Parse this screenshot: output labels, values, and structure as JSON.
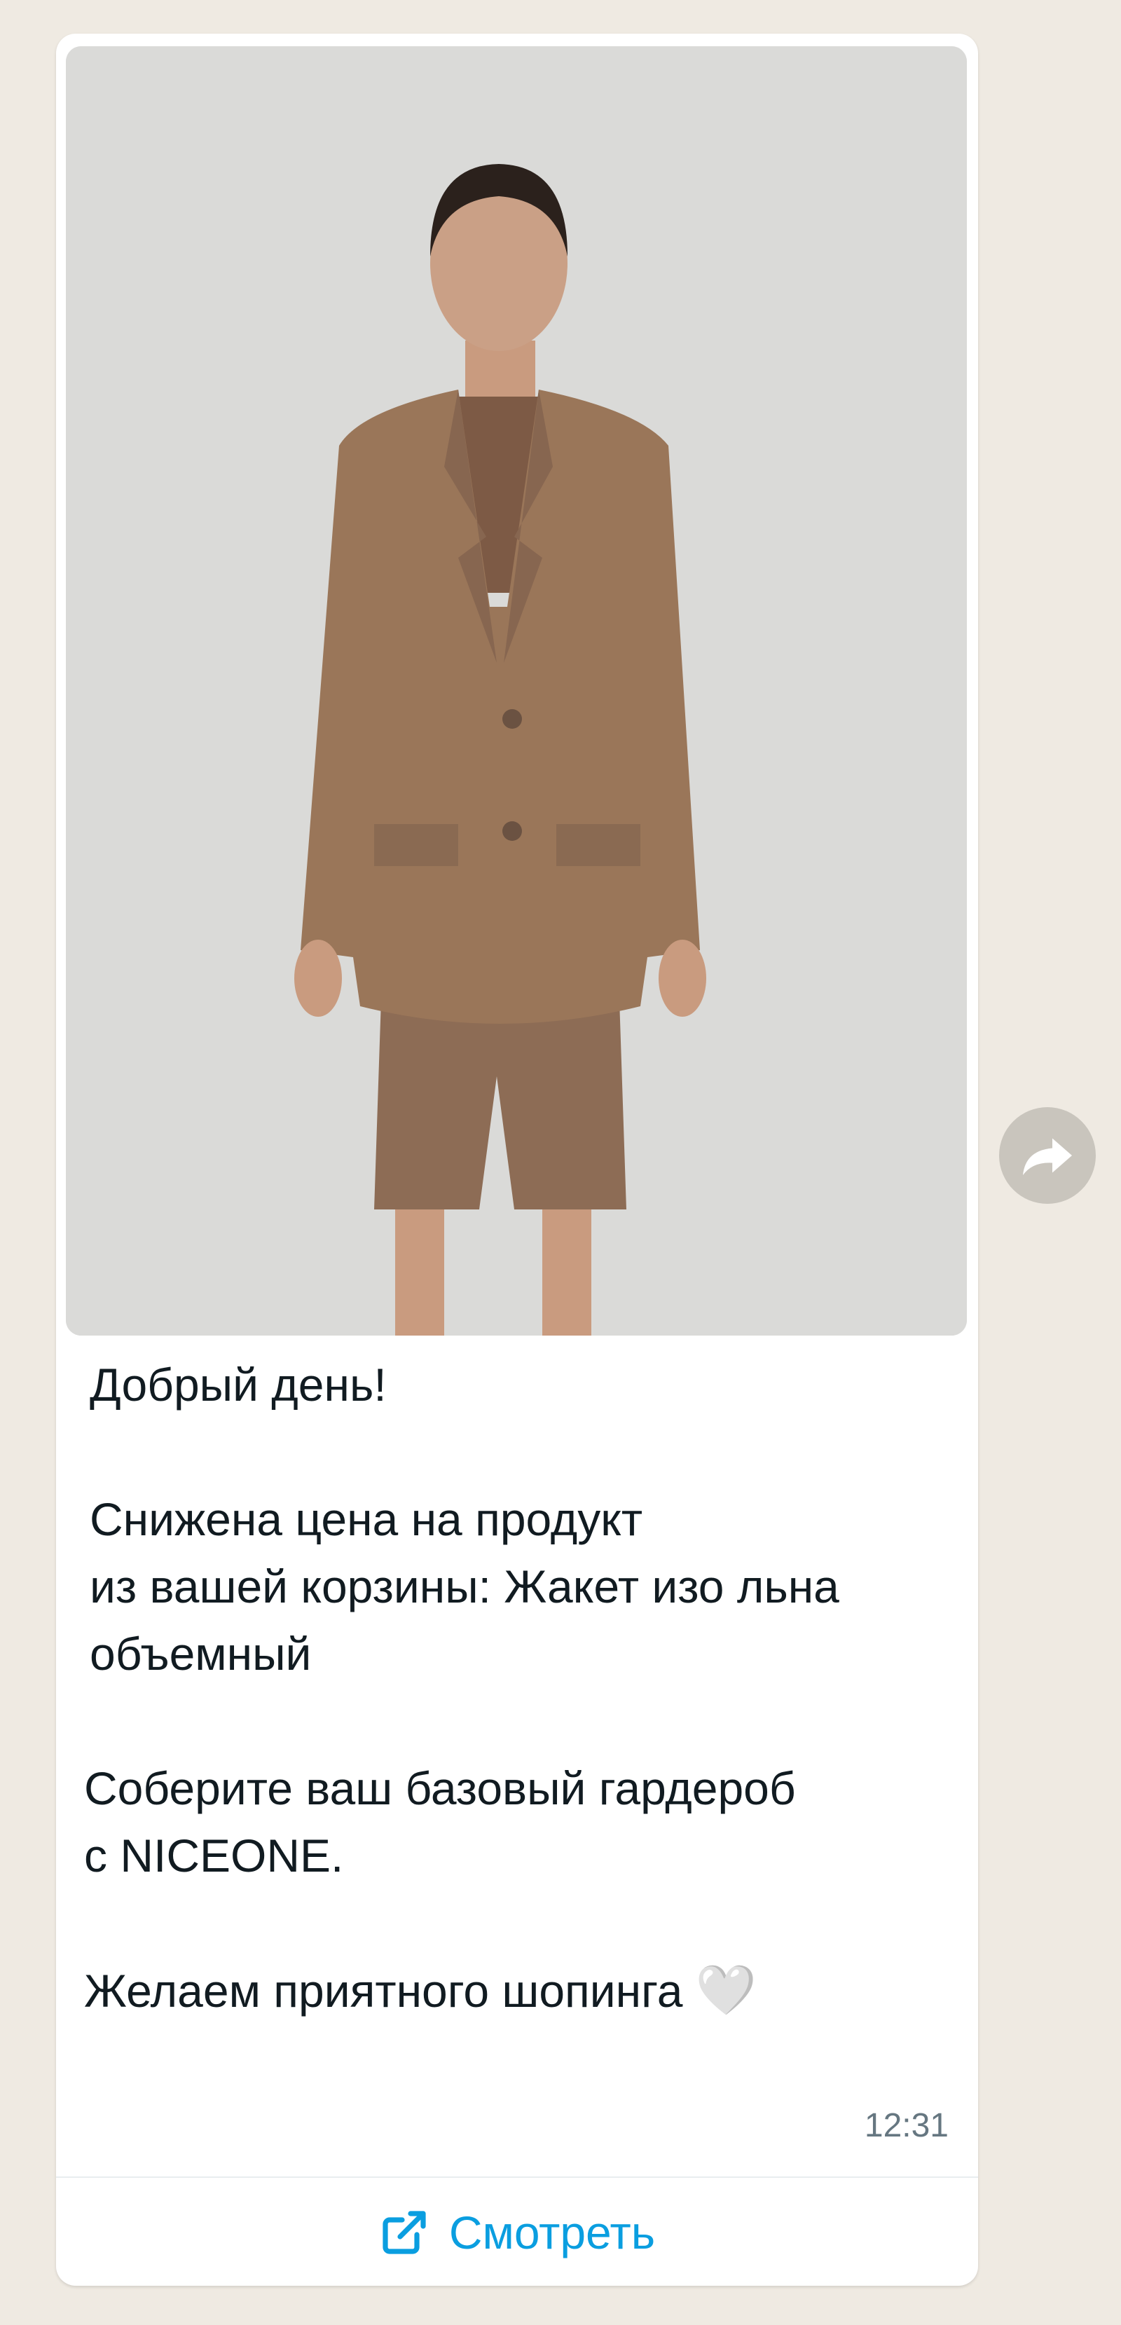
{
  "message": {
    "greeting": "Добрый день!",
    "price_notice": "Снижена цена на продукт\nиз вашей корзины: Жакет изо льна\nобъемный",
    "brand_line": "Соберите ваш базовый гардероб\nс NICEONE.",
    "closing": "Желаем приятного шопинга",
    "closing_emoji": "🤍",
    "time": "12:31"
  },
  "action_button": {
    "label": "Смотреть",
    "icon": "external-link-icon"
  },
  "share_button": {
    "icon": "forward-icon"
  },
  "colors": {
    "accent": "#0a9ee0",
    "bubble": "#ffffff",
    "background": "#efeae2",
    "text": "#111b21",
    "time": "#667781"
  }
}
